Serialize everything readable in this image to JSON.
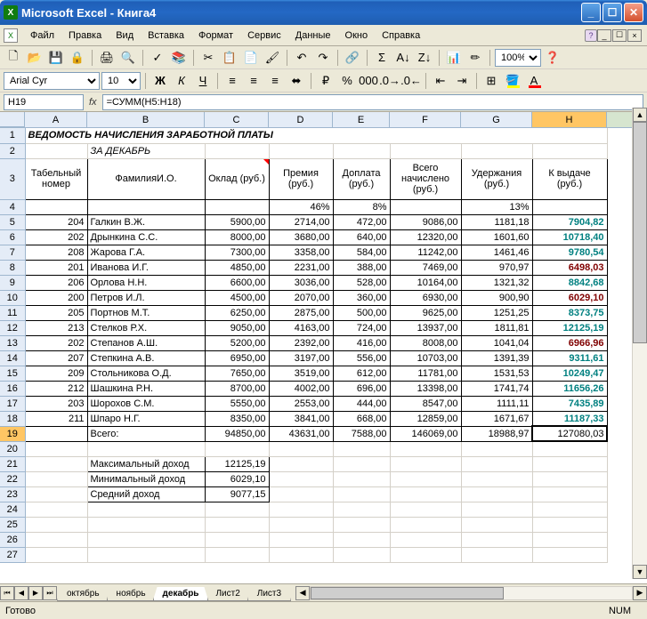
{
  "app_title": "Microsoft Excel - Книга4",
  "menus": {
    "file": "Файл",
    "edit": "Правка",
    "view": "Вид",
    "insert": "Вставка",
    "format": "Формат",
    "tools": "Сервис",
    "data": "Данные",
    "window": "Окно",
    "help": "Справка"
  },
  "font_name": "Arial Cyr",
  "font_size": "10",
  "zoom": "100%",
  "namebox": "H19",
  "formula": "=СУММ(H5:H18)",
  "columns": [
    "A",
    "B",
    "C",
    "D",
    "E",
    "F",
    "G",
    "H"
  ],
  "sheet": {
    "title": "ВЕДОМОСТЬ НАЧИСЛЕНИЯ ЗАРАБОТНОЙ ПЛАТЫ",
    "subtitle": "ЗА ДЕКАБРЬ",
    "headers": {
      "tabnum": "Табельный номер",
      "fio": "ФамилияИ.О.",
      "oklad": "Оклад (руб.)",
      "prem": "Премия (руб.)",
      "dopl": "Доплата (руб.)",
      "total": "Всего начислено (руб.)",
      "uder": "Удержания (руб.)",
      "pay": "К выдаче (руб.)"
    },
    "perc": {
      "prem": "46%",
      "dopl": "8%",
      "uder": "13%"
    },
    "rows": [
      {
        "n": "204",
        "f": "Галкин В.Ж.",
        "o": "5900,00",
        "p": "2714,00",
        "d": "472,00",
        "t": "9086,00",
        "u": "1181,18",
        "k": "7904,82",
        "c": "teal"
      },
      {
        "n": "202",
        "f": "Дрынкина С.С.",
        "o": "8000,00",
        "p": "3680,00",
        "d": "640,00",
        "t": "12320,00",
        "u": "1601,60",
        "k": "10718,40",
        "c": "teal"
      },
      {
        "n": "208",
        "f": "Жарова Г.А.",
        "o": "7300,00",
        "p": "3358,00",
        "d": "584,00",
        "t": "11242,00",
        "u": "1461,46",
        "k": "9780,54",
        "c": "teal"
      },
      {
        "n": "201",
        "f": "Иванова И.Г.",
        "o": "4850,00",
        "p": "2231,00",
        "d": "388,00",
        "t": "7469,00",
        "u": "970,97",
        "k": "6498,03",
        "c": "red"
      },
      {
        "n": "206",
        "f": "Орлова Н.Н.",
        "o": "6600,00",
        "p": "3036,00",
        "d": "528,00",
        "t": "10164,00",
        "u": "1321,32",
        "k": "8842,68",
        "c": "teal"
      },
      {
        "n": "200",
        "f": "Петров И.Л.",
        "o": "4500,00",
        "p": "2070,00",
        "d": "360,00",
        "t": "6930,00",
        "u": "900,90",
        "k": "6029,10",
        "c": "red"
      },
      {
        "n": "205",
        "f": "Портнов М.Т.",
        "o": "6250,00",
        "p": "2875,00",
        "d": "500,00",
        "t": "9625,00",
        "u": "1251,25",
        "k": "8373,75",
        "c": "teal"
      },
      {
        "n": "213",
        "f": "Стелков Р.Х.",
        "o": "9050,00",
        "p": "4163,00",
        "d": "724,00",
        "t": "13937,00",
        "u": "1811,81",
        "k": "12125,19",
        "c": "teal"
      },
      {
        "n": "202",
        "f": "Степанов А.Ш.",
        "o": "5200,00",
        "p": "2392,00",
        "d": "416,00",
        "t": "8008,00",
        "u": "1041,04",
        "k": "6966,96",
        "c": "red"
      },
      {
        "n": "207",
        "f": "Степкина А.В.",
        "o": "6950,00",
        "p": "3197,00",
        "d": "556,00",
        "t": "10703,00",
        "u": "1391,39",
        "k": "9311,61",
        "c": "teal"
      },
      {
        "n": "209",
        "f": "Стольникова О.Д.",
        "o": "7650,00",
        "p": "3519,00",
        "d": "612,00",
        "t": "11781,00",
        "u": "1531,53",
        "k": "10249,47",
        "c": "teal"
      },
      {
        "n": "212",
        "f": "Шашкина Р.Н.",
        "o": "8700,00",
        "p": "4002,00",
        "d": "696,00",
        "t": "13398,00",
        "u": "1741,74",
        "k": "11656,26",
        "c": "teal"
      },
      {
        "n": "203",
        "f": "Шорохов С.М.",
        "o": "5550,00",
        "p": "2553,00",
        "d": "444,00",
        "t": "8547,00",
        "u": "1111,11",
        "k": "7435,89",
        "c": "teal"
      },
      {
        "n": "211",
        "f": "Шпаро Н.Г.",
        "o": "8350,00",
        "p": "3841,00",
        "d": "668,00",
        "t": "12859,00",
        "u": "1671,67",
        "k": "11187,33",
        "c": "teal"
      }
    ],
    "totals": {
      "label": "Всего:",
      "o": "94850,00",
      "p": "43631,00",
      "d": "7588,00",
      "t": "146069,00",
      "u": "18988,97",
      "k": "127080,03"
    },
    "stats": {
      "max_l": "Максимальный доход",
      "max_v": "12125,19",
      "min_l": "Минимальный доход",
      "min_v": "6029,10",
      "avg_l": "Средний доход",
      "avg_v": "9077,15"
    }
  },
  "tabs": [
    "октябрь",
    "ноябрь",
    "декабрь",
    "Лист2",
    "Лист3"
  ],
  "active_tab": "декабрь",
  "status": "Готово",
  "numlock": "NUM",
  "chart_data": null
}
